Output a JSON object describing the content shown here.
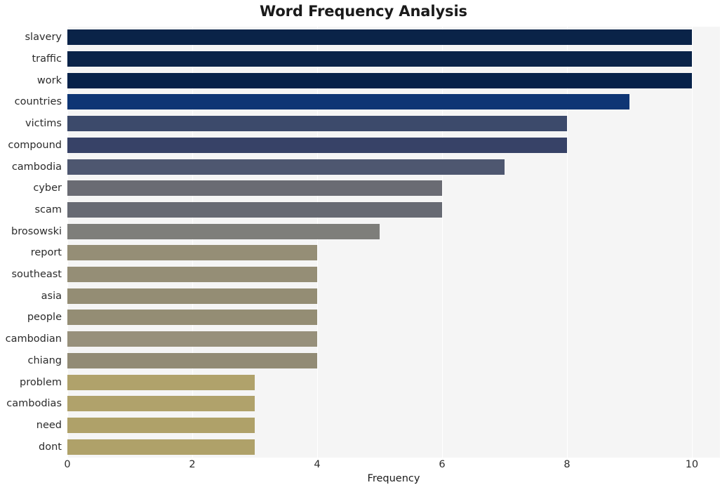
{
  "chart_data": {
    "type": "bar",
    "orientation": "horizontal",
    "title": "Word Frequency Analysis",
    "xlabel": "Frequency",
    "ylabel": "",
    "xlim": [
      0,
      10.45
    ],
    "xticks": [
      0,
      2,
      4,
      6,
      8,
      10
    ],
    "xtick_labels": [
      "0",
      "2",
      "4",
      "6",
      "8",
      "10"
    ],
    "grid": true,
    "grid_axis": "x",
    "legend": null,
    "categories": [
      "slavery",
      "traffic",
      "work",
      "countries",
      "victims",
      "compound",
      "cambodia",
      "cyber",
      "scam",
      "brosowski",
      "report",
      "southeast",
      "asia",
      "people",
      "cambodian",
      "chiang",
      "problem",
      "cambodias",
      "need",
      "dont"
    ],
    "values": [
      10,
      10,
      10,
      9,
      8,
      8,
      7,
      6,
      6,
      5,
      4,
      4,
      4,
      4,
      4,
      4,
      3,
      3,
      3,
      3
    ],
    "bar_colors": [
      "#0a2348",
      "#0a2348",
      "#07224a",
      "#0e3574",
      "#3c4a6b",
      "#374267",
      "#4e5770",
      "#6a6b73",
      "#676a73",
      "#7e7e7a",
      "#958e76",
      "#958e76",
      "#948d74",
      "#948d74",
      "#97907b",
      "#928b75",
      "#b0a26b",
      "#b0a26b",
      "#afa169",
      "#afa169"
    ],
    "plot_background": "#f5f5f5",
    "figure_background": "#ffffff",
    "gridline_color": "#ffffff"
  }
}
